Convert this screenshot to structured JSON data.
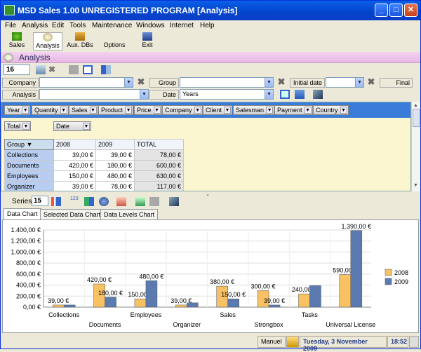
{
  "window": {
    "title": "MSD Sales 1.00 UNREGISTERED PROGRAM [Analysis]"
  },
  "menu": [
    "File",
    "Analysis",
    "Edit",
    "Tools",
    "Maintenance",
    "Windows",
    "Internet",
    "Help"
  ],
  "toolbar": {
    "items": [
      {
        "label": "Sales",
        "icon": "sales-icon"
      },
      {
        "label": "Analysis",
        "icon": "analysis-icon"
      },
      {
        "label": "Aux. DBs",
        "icon": "database-icon"
      },
      {
        "label": "Options",
        "icon": "options-icon"
      },
      {
        "label": "Exit",
        "icon": "exit-icon"
      }
    ]
  },
  "header": {
    "title": "Analysis"
  },
  "row1": {
    "number": "16"
  },
  "filters": {
    "company_label": "Company",
    "company_value": "",
    "group_label": "Group",
    "group_value": "",
    "initial_date_label": "Initial date",
    "initial_date_value": "",
    "final_date_label": "Final date",
    "analysis_label": "Analysis",
    "analysis_value": "",
    "date_label": "Date",
    "date_value": "Years"
  },
  "pivot": {
    "fields": [
      "Year",
      "Quantity",
      "Sales",
      "Product",
      "Price",
      "Company",
      "Client",
      "Salesman",
      "Payment",
      "Country"
    ],
    "data_field": "Total",
    "column_field": "Date",
    "row_field": "Group",
    "column_headers": [
      "2008",
      "2009",
      "TOTAL"
    ],
    "rows": [
      {
        "name": "Collections",
        "v2008": "39,00 €",
        "v2009": "39,00 €",
        "total": "78,00 €"
      },
      {
        "name": "Documents",
        "v2008": "420,00 €",
        "v2009": "180,00 €",
        "total": "600,00 €"
      },
      {
        "name": "Employees",
        "v2008": "150,00 €",
        "v2009": "480,00 €",
        "total": "630,00 €"
      },
      {
        "name": "Organizer",
        "v2008": "39,00 €",
        "v2009": "78,00 €",
        "total": "117,00 €"
      }
    ]
  },
  "lower": {
    "series_label": "Series",
    "series_value": "15"
  },
  "tabs": [
    "Data Chart",
    "Selected Data Chart",
    "Data Levels Chart"
  ],
  "colors": {
    "s2008": "#f7c164",
    "s2009": "#5a7ab0"
  },
  "chart_data": {
    "type": "bar",
    "categories": [
      "Collections",
      "Documents",
      "Employees",
      "Organizer",
      "Sales",
      "Strongbox",
      "Tasks",
      "Universal License"
    ],
    "series": [
      {
        "name": "2008",
        "values": [
          39,
          420,
          150,
          39,
          380,
          300,
          240,
          590
        ]
      },
      {
        "name": "2009",
        "values": [
          39,
          180,
          480,
          78,
          150,
          39,
          390,
          1390
        ]
      }
    ],
    "value_labels": {
      "2008": [
        "39,00 €",
        "420,00 €",
        "150,00 €",
        "39,00 €",
        "380,00 €",
        "300,00 €",
        "240,00 €",
        "590,00 €"
      ],
      "2009": [
        "",
        "180,00 €",
        "480,00 €",
        "",
        "150,00 €",
        "39,00 €",
        "",
        "1.390,00 €"
      ]
    },
    "yticks": [
      "0,00 €",
      "200,00 €",
      "400,00 €",
      "600,00 €",
      "800,00 €",
      "1.000,00 €",
      "1.200,00 €",
      "1.400,00 €"
    ],
    "ylim": [
      0,
      1400
    ],
    "legend": "right",
    "grid": true
  },
  "status": {
    "user": "Manuel",
    "date": "Tuesday, 3 November 2009",
    "time": "18:52"
  }
}
